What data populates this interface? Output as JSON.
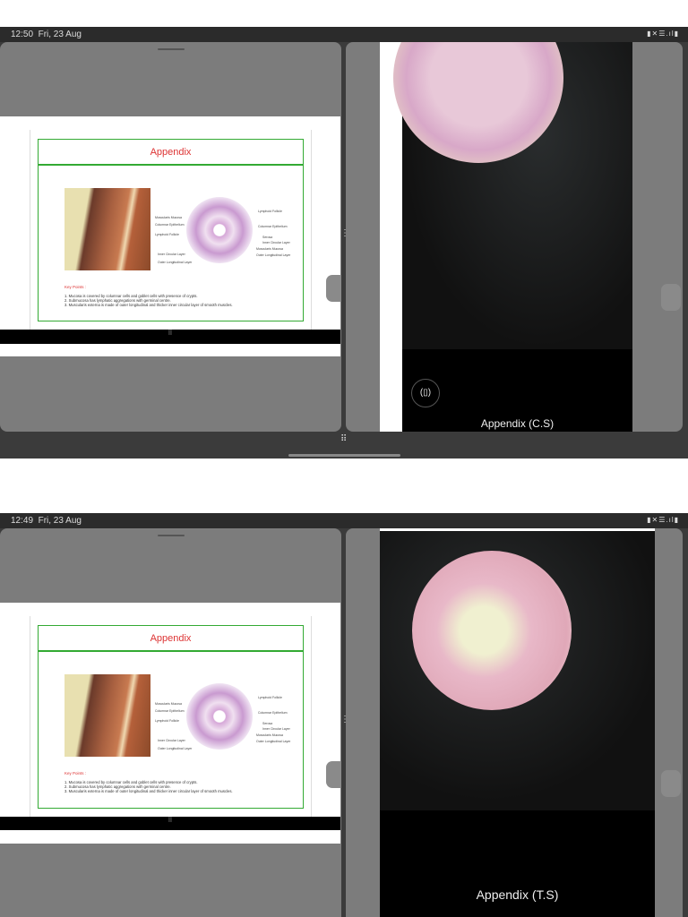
{
  "screens": [
    {
      "status": {
        "time": "12:50",
        "date": "Fri, 23 Aug",
        "icons": "▮✕☰.ıl▮"
      },
      "slide": {
        "title": "Appendix",
        "labels_left": [
          "Muscularis Mucosa",
          "Columnar Epithelium",
          "Lymphoid Follicle",
          "Inner Circular Layer",
          "Outer Longitudinal Layer"
        ],
        "labels_right": [
          "Lymphoid Follicle",
          "Columnar Epithelium",
          "Serosa",
          "Inner Circular Layer",
          "Muscularis Mucosa",
          "Outer Longitudinal Layer"
        ],
        "key_points_title": "Key Points :",
        "key_points": [
          "1.  Mucosa is covered by columnar cells and goblet cells  with presence of crypts.",
          "2.  Submucosa has lymphatic aggregations with germinal centre.",
          "3.  Muscularis externa is made of outer longitudinal and thicker inner circular layer of smooth muscles."
        ]
      },
      "caption": "Appendix (C.S)",
      "rotate_icon": "(▯)"
    },
    {
      "status": {
        "time": "12:49",
        "date": "Fri, 23 Aug",
        "icons": "▮✕☰.ıl▮"
      },
      "caption": "Appendix (T.S)"
    }
  ],
  "icons": {
    "grid": "⠿",
    "dots": "⋮",
    "rotate": "rotate-icon"
  }
}
